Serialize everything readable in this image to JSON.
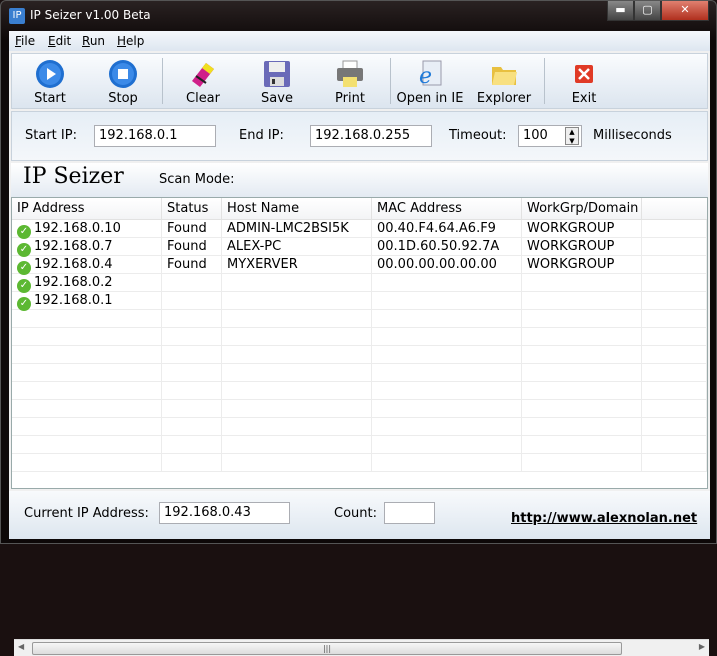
{
  "window": {
    "title": "IP Seizer v1.00 Beta",
    "app_icon": "IP"
  },
  "menu": [
    "File",
    "Edit",
    "Run",
    "Help"
  ],
  "toolbar": [
    {
      "label": "Start",
      "icon": "play-icon"
    },
    {
      "label": "Stop",
      "icon": "stop-icon"
    },
    {
      "label": "Clear",
      "icon": "eraser-icon"
    },
    {
      "label": "Save",
      "icon": "floppy-icon"
    },
    {
      "label": "Print",
      "icon": "printer-icon"
    },
    {
      "label": "Open in IE",
      "icon": "ie-icon"
    },
    {
      "label": "Explorer",
      "icon": "folder-icon"
    },
    {
      "label": "Exit",
      "icon": "exit-icon"
    }
  ],
  "scan": {
    "start_label": "Start IP:",
    "start_value": "192.168.0.1",
    "end_label": "End IP:",
    "end_value": "192.168.0.255",
    "timeout_label": "Timeout:",
    "timeout_value": "100",
    "timeout_unit": "Milliseconds"
  },
  "header": {
    "title": "IP Seizer",
    "scan_mode_label": "Scan Mode:"
  },
  "table": {
    "columns": [
      "IP Address",
      "Status",
      "Host Name",
      "MAC Address",
      "WorkGrp/Domain"
    ],
    "rows": [
      [
        "192.168.0.10",
        "Found",
        "ADMIN-LMC2BSI5K",
        "00.40.F4.64.A6.F9",
        "WORKGROUP"
      ],
      [
        "192.168.0.7",
        "Found",
        "ALEX-PC",
        "00.1D.60.50.92.7A",
        "WORKGROUP"
      ],
      [
        "192.168.0.4",
        "Found",
        "MYXERVER",
        "00.00.00.00.00.00",
        "WORKGROUP"
      ],
      [
        "192.168.0.2",
        "",
        "",
        "",
        ""
      ],
      [
        "192.168.0.1",
        "",
        "",
        "",
        ""
      ]
    ]
  },
  "footer": {
    "current_label": "Current IP Address:",
    "current_value": "192.168.0.43",
    "count_label": "Count:",
    "count_value": "",
    "link": "http://www.alexnolan.net"
  }
}
